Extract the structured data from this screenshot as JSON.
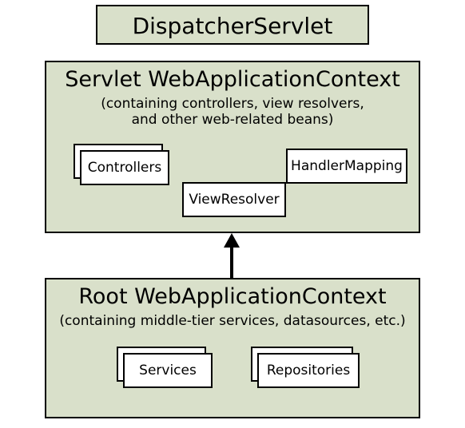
{
  "dispatcher": {
    "title": "DispatcherServlet"
  },
  "servletContext": {
    "title": "Servlet WebApplicationContext",
    "subtitle1": "(containing controllers, view resolvers,",
    "subtitle2": "and other web-related beans)",
    "controllers": "Controllers",
    "viewResolver": "ViewResolver",
    "handlerMapping": "HandlerMapping"
  },
  "rootContext": {
    "title": "Root WebApplicationContext",
    "subtitle": "(containing middle-tier services, datasources, etc.)",
    "services": "Services",
    "repositories": "Repositories"
  }
}
